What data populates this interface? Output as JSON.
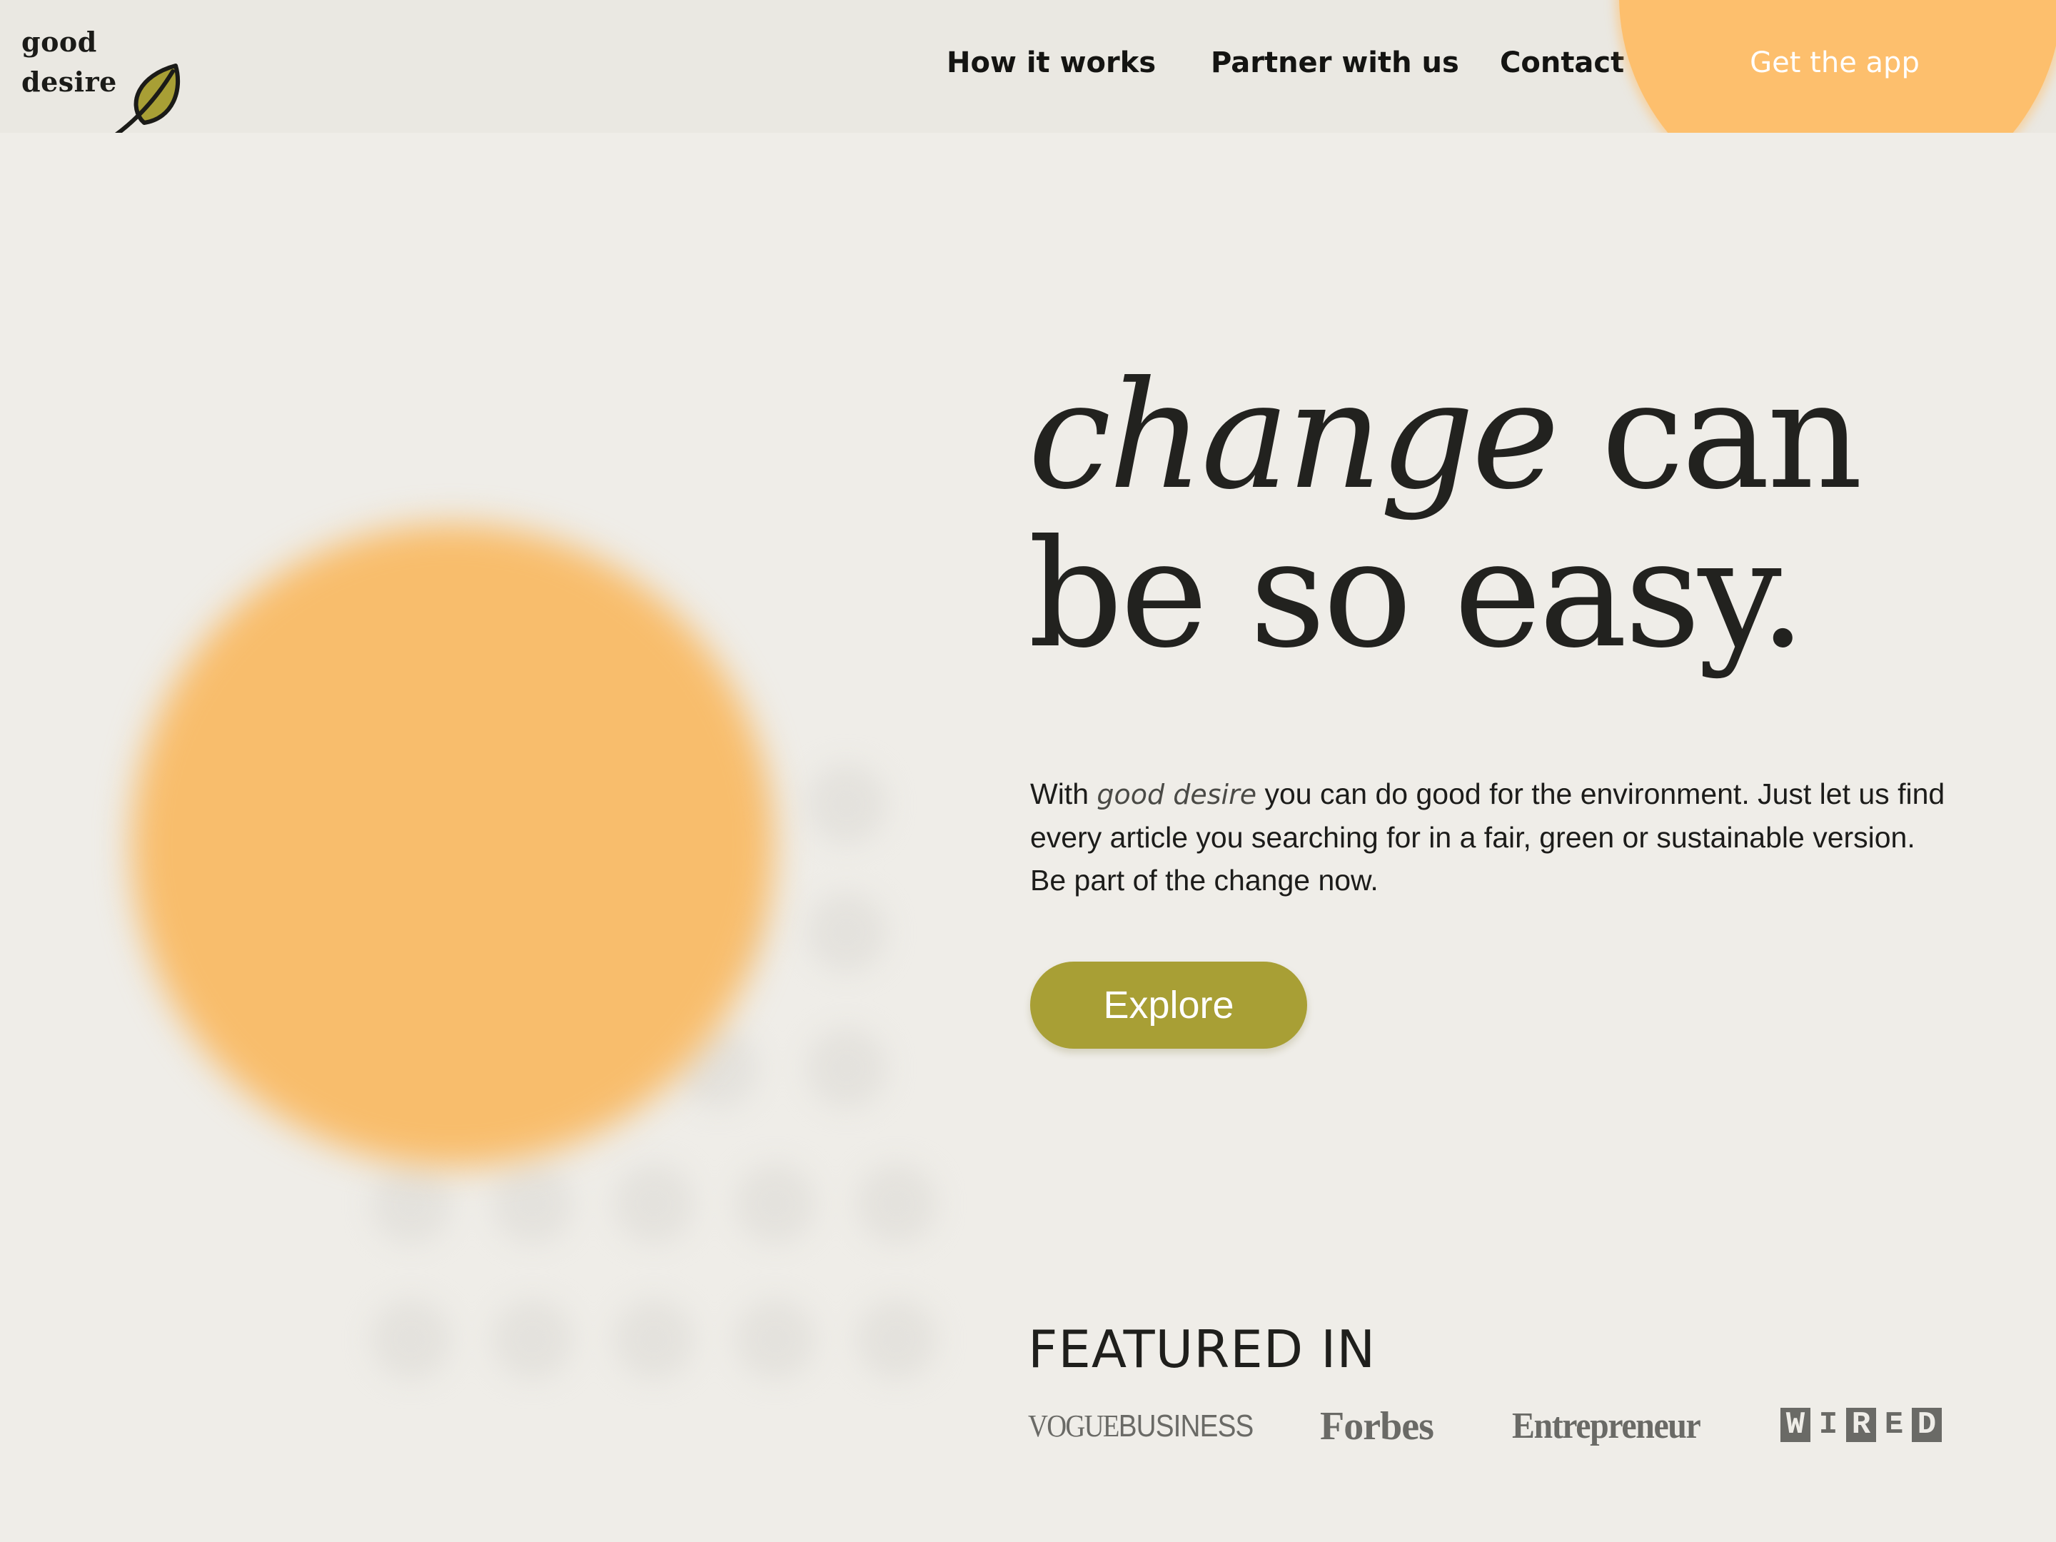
{
  "brand": {
    "name_line1": "good",
    "name_line2": "desire",
    "logo_icon": "leaf-icon",
    "leaf_color": "#a89f35"
  },
  "nav": {
    "items": [
      {
        "label": "How it works"
      },
      {
        "label": "Partner with us"
      },
      {
        "label": "Contact"
      }
    ],
    "cta_label": "Get the app",
    "cta_color": "#fdbf6d"
  },
  "hero": {
    "headline_word_italic": "change",
    "headline_word_rest": " can",
    "headline_line2": "be so easy.",
    "lead_prefix": "With ",
    "lead_brand": "good desire",
    "lead_suffix": " you can do good for the environment. Just let us find every article you searching for in a fair, green or sustainable version. Be part of the change now.",
    "button_label": "Explore",
    "button_color": "#a89f35",
    "sun_color": "#f8bd6c"
  },
  "featured": {
    "title": "FEATURED IN",
    "logos": {
      "vogue_a": "VOGUE",
      "vogue_b": "BUSINESS",
      "forbes": "Forbes",
      "entrepreneur": "Entrepreneur",
      "wired": [
        "W",
        "I",
        "R",
        "E",
        "D"
      ]
    }
  },
  "colors": {
    "background": "#efede8",
    "header_background": "#eae8e2",
    "text": "#1f1f1c",
    "press_logo_gray": "#6a6a66"
  }
}
